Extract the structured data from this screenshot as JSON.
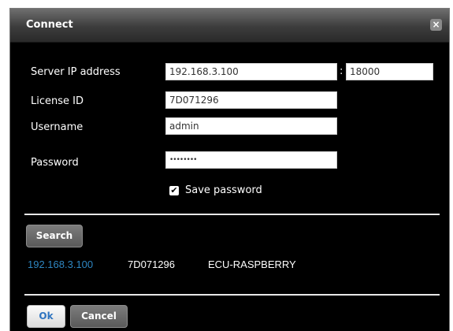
{
  "dialog": {
    "title": "Connect",
    "close_glyph": "×"
  },
  "form": {
    "server_ip_label": "Server IP address",
    "server_ip_value": "192.168.3.100",
    "port_separator": ":",
    "port_value": "18000",
    "license_label": "License ID",
    "license_value": "7D071296",
    "username_label": "Username",
    "username_value": "admin",
    "password_label": "Password",
    "password_mask": "••••••••",
    "save_password_label": "Save password",
    "save_password_checked": true,
    "check_glyph": "✔"
  },
  "search": {
    "button_label": "Search",
    "results": [
      {
        "ip": "192.168.3.100",
        "license": "7D071296",
        "name": "ECU-RASPBERRY"
      }
    ]
  },
  "footer": {
    "ok_label": "Ok",
    "cancel_label": "Cancel"
  },
  "colors": {
    "accent_link": "#2e86c1",
    "background": "#000000"
  }
}
